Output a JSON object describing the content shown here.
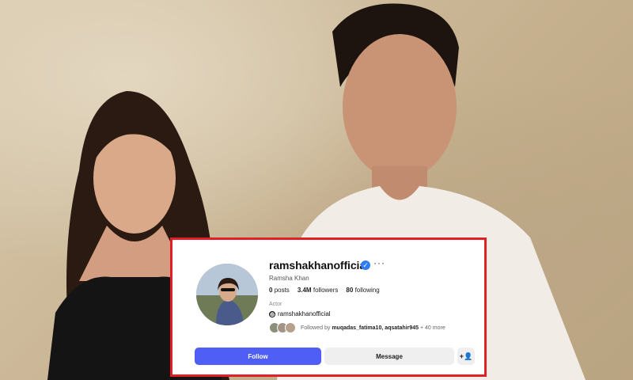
{
  "profile": {
    "username": "ramshakhanofficial",
    "more_icon": "ellipsis-icon",
    "verified_icon": "verified-badge-icon",
    "full_name": "Ramsha Khan",
    "stats": {
      "posts_count": "0",
      "posts_label": "posts",
      "followers_count": "3.4M",
      "followers_label": "followers",
      "following_count": "80",
      "following_label": "following"
    },
    "category": "Actor",
    "threads_handle": "ramshakhanofficial",
    "followed_by_prefix": "Followed by",
    "followed_by_names": "muqadas_fatima10, aqsatahir945",
    "followed_by_suffix": "+ 40 more"
  },
  "actions": {
    "follow_label": "Follow",
    "message_label": "Message",
    "add_user_icon": "add-user-icon"
  },
  "colors": {
    "highlight_border": "#e01f26",
    "follow_button": "#4f5ff5",
    "verified": "#2f7df6"
  }
}
